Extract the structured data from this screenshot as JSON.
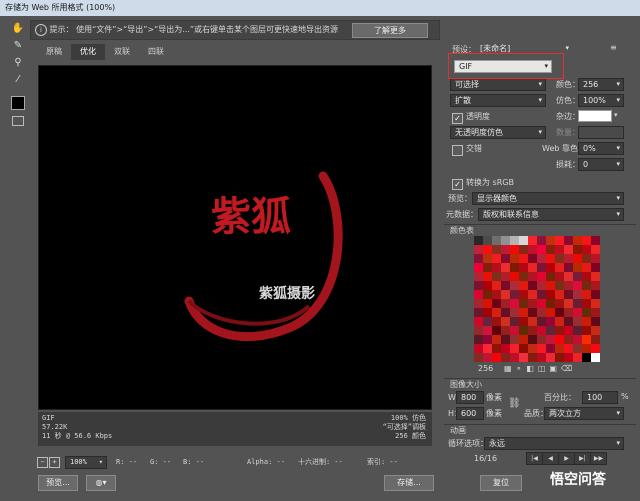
{
  "window": {
    "title": "存储为 Web 所用格式 (100%)"
  },
  "hint": {
    "label": "提示：",
    "text": "使用“文件”>“导出”>“导出为...”或右键单击某个图层可更快速地导出资源",
    "learn_more": "了解更多"
  },
  "tabs": [
    {
      "label": "原稿"
    },
    {
      "label": "优化"
    },
    {
      "label": "双联"
    },
    {
      "label": "四联"
    }
  ],
  "artwork": {
    "calligraphy": "紫狐",
    "subtitle": "紫狐摄影"
  },
  "image_info": {
    "format": "GIF",
    "size": "57.22K",
    "time": "11 秒 @ 56.6 Kbps",
    "quality": "100% 仿色",
    "palette": "“可选择”调板",
    "colors": "256 颜色"
  },
  "bottom_bar": {
    "zoom": "100%",
    "r": "R: --",
    "g": "G: --",
    "b": "B: --",
    "alpha": "Alpha: --",
    "hex": "十六进制: --",
    "index": "索引: --"
  },
  "footer": {
    "preview": "预览...",
    "save": "存储...",
    "reset": "复位"
  },
  "settings": {
    "preset_label": "预设：",
    "preset_value": "[未命名]",
    "format": "GIF",
    "reduction": "可选择",
    "colors_label": "颜色：",
    "colors_value": "256",
    "dither_algo": "扩散",
    "dither_label": "仿色：",
    "dither_value": "100%",
    "transparency": "透明度",
    "matte_label": "杂边：",
    "trans_dither": "无透明度仿色",
    "amount_label": "数量：",
    "interlaced": "交错",
    "web_snap_label": "Web 靠色：",
    "web_snap_value": "0%",
    "lossy_label": "损耗：",
    "lossy_value": "0",
    "convert_srgb": "转换为 sRGB",
    "preview_label": "预览：",
    "preview_value": "显示器颜色",
    "metadata_label": "元数据：",
    "metadata_value": "版权和联系信息",
    "color_table_title": "颜色表",
    "color_count": "256",
    "image_size_title": "图像大小",
    "w_label": "W：",
    "w_value": "800",
    "h_label": "H：",
    "h_value": "600",
    "unit": "像素",
    "percent_label": "百分比：",
    "percent_value": "100",
    "percent_unit": "%",
    "quality_label": "品质：",
    "quality_value": "两次立方",
    "animation_title": "动画",
    "loop_label": "循环选项：",
    "loop_value": "永远",
    "frame_counter": "16/16"
  },
  "watermark": "悟空问答",
  "colors": {
    "accent": "#e03030",
    "panel_bg": "#535353",
    "canvas_bg": "#000000"
  }
}
